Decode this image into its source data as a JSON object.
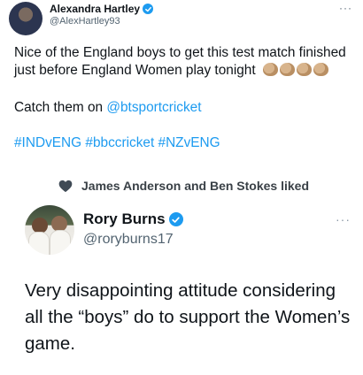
{
  "tweet1": {
    "author_name": "Alexandra Hartley",
    "author_handle": "@AlexHartley93",
    "more_label": "···",
    "text_line1": "Nice of the England boys to get this test match finished just before England Women play tonight",
    "emoji": [
      "clapping-hands-icon",
      "clapping-hands-icon",
      "clapping-hands-icon",
      "clapping-hands-icon"
    ],
    "text_line2_prefix": "Catch them on ",
    "mention": "@btsportcricket",
    "hashtags": "#INDvENG #bbccricket #NZvENG"
  },
  "social_context": {
    "icon": "heart-icon",
    "text": "James Anderson and Ben Stokes liked"
  },
  "tweet2": {
    "author_name": "Rory Burns",
    "author_handle": "@roryburns17",
    "more_label": "···",
    "text": "Very disappointing attitude considering all the “boys” do to support the Women’s game."
  },
  "colors": {
    "link": "#1d9bf0",
    "verified": "#1d9bf0",
    "secondary_text": "#536471",
    "primary_text": "#0f1419"
  }
}
